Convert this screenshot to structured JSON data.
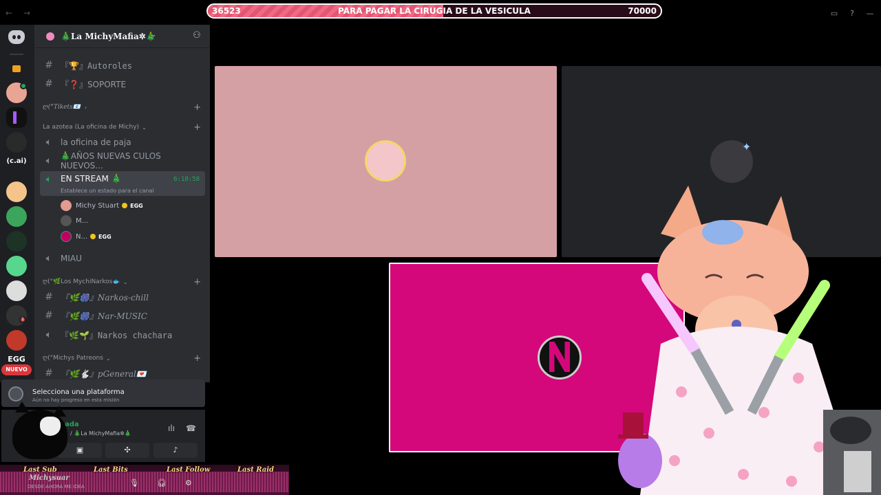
{
  "topbar": {
    "goal": {
      "current": "36523",
      "title": "PARA PAGAR LA CIRUGIA DE LA VESICULA",
      "target": "70000",
      "progress": 0.52
    },
    "icons": [
      "inbox-icon",
      "help-icon",
      "minimize-icon"
    ]
  },
  "rail": {
    "labels": {
      "cai": "(c.ai)",
      "egg": "EGG",
      "new": "NUEVO",
      "badge": "1"
    }
  },
  "server": {
    "name": "🎄La MichyMafia✲🎄"
  },
  "channels": {
    "autoroles": "『🏆』Autoroles",
    "soporte": "『❓』SOPORTE",
    "cat_tikets": "ღ(°Tikets📧",
    "cat_azotea": "La azotea (La oficina de Michy)",
    "oficina": "la oficina de paja",
    "anos": "🎄AÑOS NUEVAS CULOS NUEVOS...",
    "stream": "EN STREAM 🎄",
    "stream_time": "6:18:58",
    "stream_sub": "Establece un estado para el canal",
    "users": [
      {
        "name": "Michy Stuart",
        "tag": "EGG"
      },
      {
        "name": "M...",
        "tag": ""
      },
      {
        "name": "N...",
        "tag": "EGG"
      }
    ],
    "miau": "MIAU",
    "cat_narkos": "ღ(°🌿Los MychiNarkos🐟",
    "narkos_chill": "『🌿🎆』Narkos-chill",
    "nar_music": "『🌿🎆』Nar-MUSIC",
    "narkos_chachara": "『🌿🌱』Narkos chachara",
    "cat_patreons": "ღ(°Michys Patreons",
    "pgeneral": "『🌿🐇』pGeneral💌"
  },
  "mission": {
    "title": "Selecciona una plataforma",
    "subtitle": "Aún no hay progreso en esta misión"
  },
  "voice": {
    "status": "ada",
    "server": "/ 🎄La MichyMafia✲🎄"
  },
  "alerts": {
    "last_sub": "Last Sub",
    "last_bits": "Last Bits",
    "last_follow": "Last Follow",
    "last_raid": "Last Raid",
    "user": "Michysuar",
    "user_status": "DESDE AHORA ME IDEA"
  },
  "colors": {
    "goal_fill": "#f06a82",
    "tile_pink": "#d4a0a4",
    "tile_magenta": "#d4087a",
    "online_green": "#23a55a"
  }
}
